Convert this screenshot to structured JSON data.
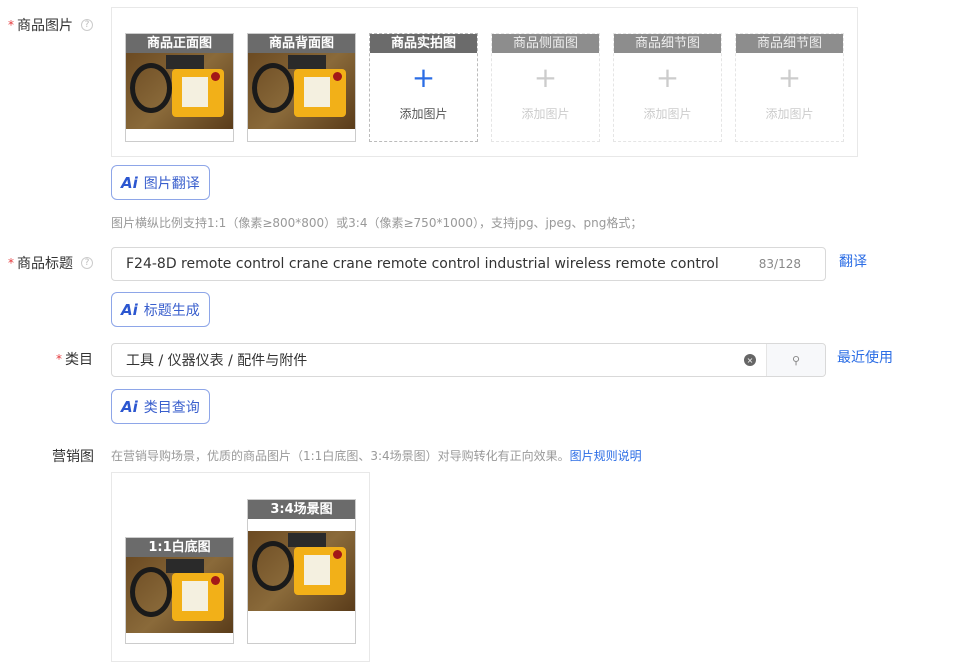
{
  "images": {
    "label": "商品图片",
    "slots": [
      {
        "title": "商品正面图",
        "filled": true
      },
      {
        "title": "商品背面图",
        "filled": true
      },
      {
        "title": "商品实拍图",
        "filled": false,
        "add_label": "添加图片"
      },
      {
        "title": "商品侧面图",
        "filled": false,
        "add_label": "添加图片"
      },
      {
        "title": "商品细节图",
        "filled": false,
        "add_label": "添加图片"
      },
      {
        "title": "商品细节图",
        "filled": false,
        "add_label": "添加图片"
      }
    ],
    "ai_button": "图片翻译",
    "hint": "图片横纵比例支持1:1（像素≥800*800）或3:4（像素≥750*1000），支持jpg、jpeg、png格式；"
  },
  "title": {
    "label": "商品标题",
    "value": "F24-8D remote control crane crane remote control industrial wireless remote control",
    "counter": "83/128",
    "translate_link": "翻译",
    "ai_button": "标题生成"
  },
  "category": {
    "label": "类目",
    "value": "工具 / 仪器仪表 / 配件与附件",
    "recent_link": "最近使用",
    "ai_button": "类目查询"
  },
  "marketing": {
    "label": "营销图",
    "hint": "在营销导购场景，优质的商品图片（1:1白底图、3:4场景图）对导购转化有正向效果。",
    "rules_link": "图片规则说明",
    "slots": [
      {
        "title": "1:1白底图"
      },
      {
        "title": "3:4场景图"
      }
    ]
  },
  "ai_badge": "Ai",
  "colors": {
    "accent": "#2b6de5",
    "required": "#e4393c"
  }
}
